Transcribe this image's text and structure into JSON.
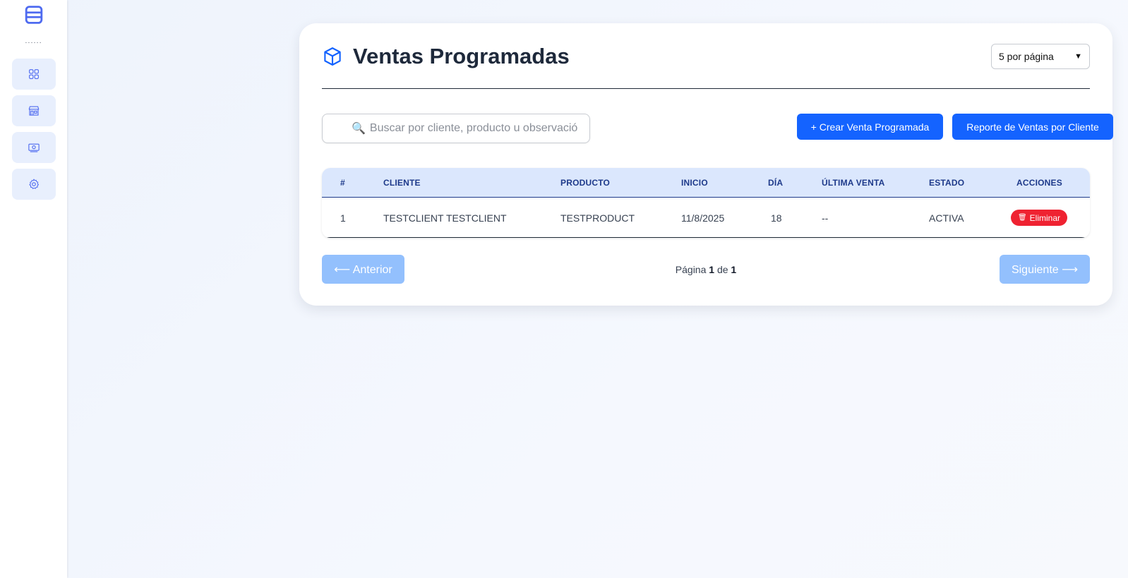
{
  "colors": {
    "accent": "#1463ff",
    "danger": "#ef2231",
    "disabled": "#93c0fd",
    "header_bg": "#dbe7fd",
    "header_text": "#1e3a8a"
  },
  "sidebar": {
    "logo_icon": "stack-layers-icon",
    "dots": "......",
    "items": [
      {
        "icon": "grid-icon"
      },
      {
        "icon": "store-icon"
      },
      {
        "icon": "cash-icon"
      },
      {
        "icon": "gear-icon"
      }
    ]
  },
  "header": {
    "icon": "box-icon",
    "title": "Ventas Programadas",
    "per_page_selected": "5 por página"
  },
  "toolbar": {
    "search_icon": "🔍",
    "search_placeholder": "Buscar por cliente, producto u observació",
    "create_label": "+ Crear Venta Programada",
    "report_label": "Reporte de Ventas por Cliente"
  },
  "table": {
    "columns": [
      "#",
      "CLIENTE",
      "PRODUCTO",
      "INICIO",
      "DÍA",
      "ÚLTIMA VENTA",
      "ESTADO",
      "ACCIONES"
    ],
    "rows": [
      {
        "num": "1",
        "cliente": "TESTCLIENT TESTCLIENT",
        "producto": "TESTPRODUCT",
        "inicio": "11/8/2025",
        "dia": "18",
        "ultima_venta": "--",
        "estado": "ACTIVA",
        "delete_icon": "🗑",
        "delete_label": "Eliminar"
      }
    ]
  },
  "pager": {
    "prev_label": "⟵ Anterior",
    "next_label": "Siguiente ⟶",
    "page_word": "Página",
    "current": "1",
    "of_word": "de",
    "total": "1"
  }
}
